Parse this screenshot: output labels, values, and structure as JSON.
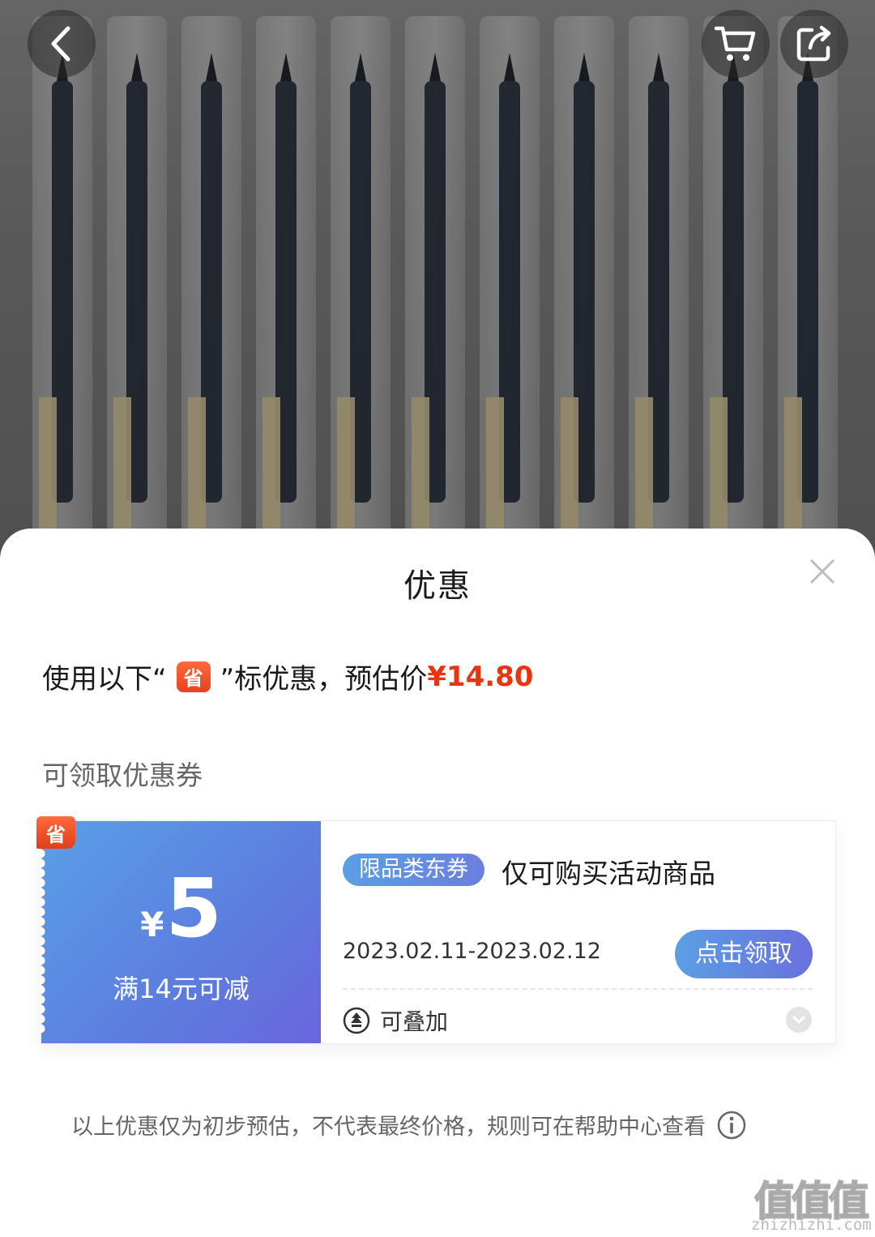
{
  "header_icons": {
    "back": "chevron-left-icon",
    "cart": "shopping-cart-icon",
    "share": "share-icon"
  },
  "sheet": {
    "title": "优惠",
    "close_icon": "close-icon",
    "summary_prefix": "使用以下“",
    "summary_badge": "省",
    "summary_suffix": "”标优惠，预估价",
    "price": "¥14.80",
    "section_title": "可领取优惠券"
  },
  "coupon": {
    "corner_badge": "省",
    "currency": "¥",
    "amount": "5",
    "condition": "满14元可减",
    "tag": "限品类东券",
    "description": "仅可购买活动商品",
    "validity": "2023.02.11-2023.02.12",
    "claim_label": "点击领取",
    "stack_label": "可叠加",
    "stack_icon": "stack-icon",
    "expand_icon": "chevron-down-icon"
  },
  "disclaimer": "以上优惠仅为初步预估，不代表最终价格，规则可在帮助中心查看",
  "watermark": {
    "logo": "值值值",
    "site": "zhizhizhi.com"
  },
  "colors": {
    "price_red": "#e8340f",
    "badge_orange": "#ff6a3d",
    "coupon_blue_start": "#5aa0e6",
    "coupon_blue_end": "#6a66dc"
  }
}
